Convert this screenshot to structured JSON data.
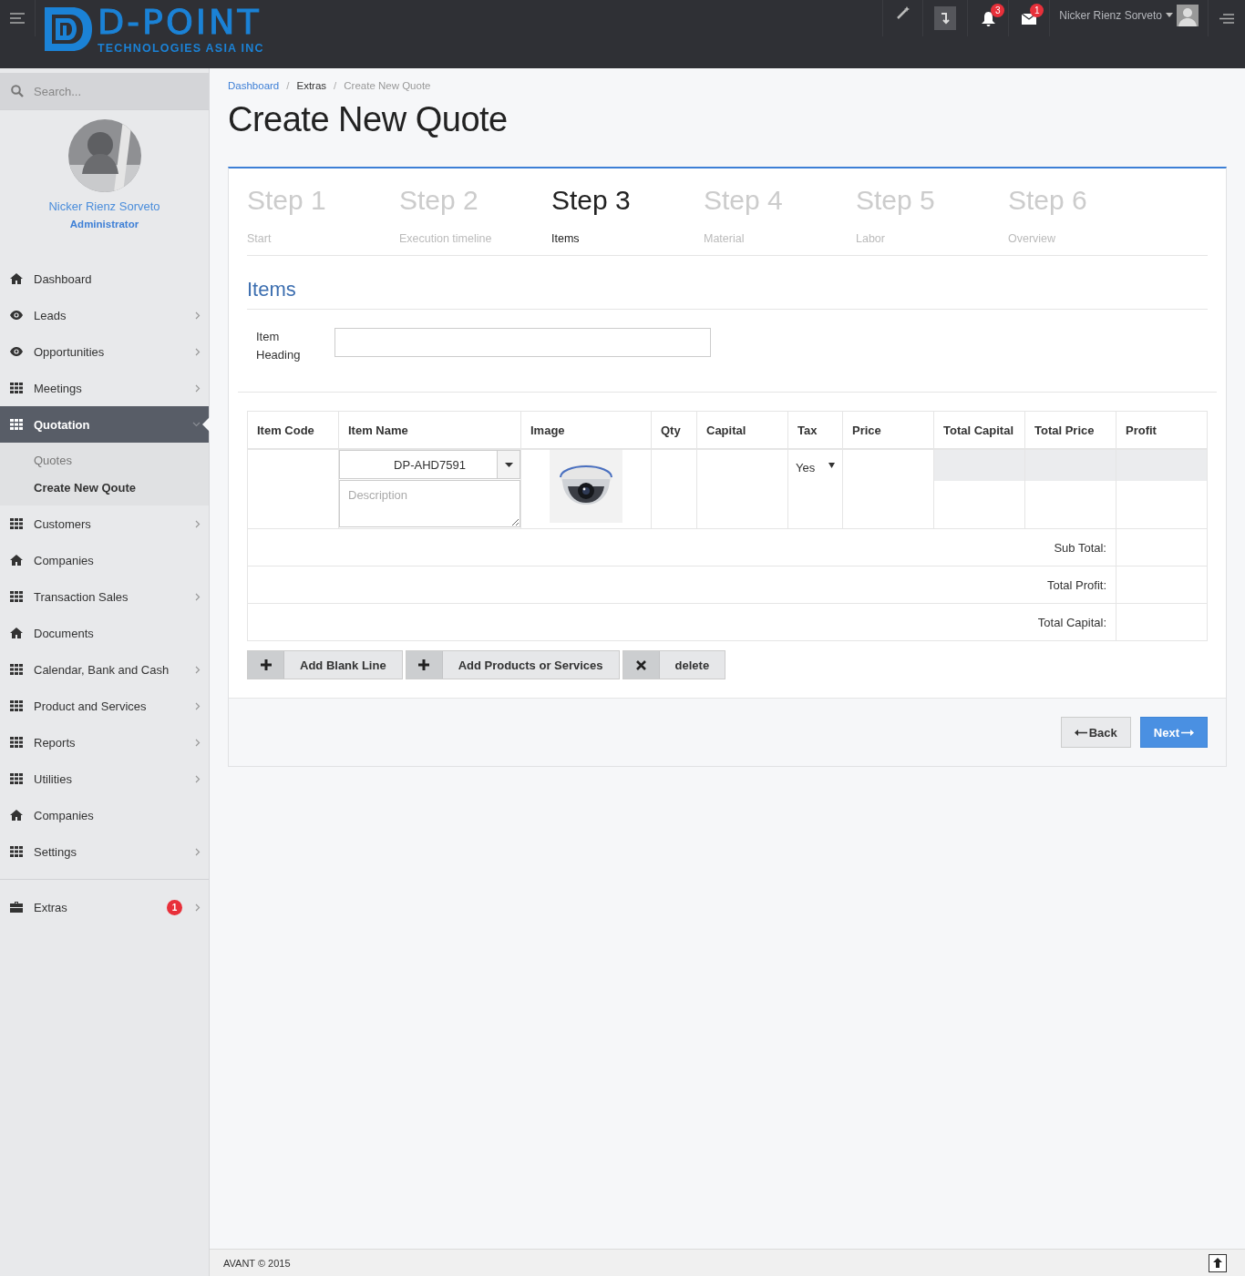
{
  "topbar": {
    "logo_title": "D-POINT",
    "logo_subtitle": "TECHNOLOGIES ASIA INC",
    "notification_count": "3",
    "message_count": "1",
    "user_name": "Nicker Rienz Sorveto"
  },
  "sidebar": {
    "search_placeholder": "Search...",
    "profile": {
      "name": "Nicker Rienz Sorveto",
      "role": "Administrator"
    },
    "items": [
      {
        "label": "Dashboard",
        "kind": "home",
        "selected": false
      },
      {
        "label": "Leads",
        "kind": "eye",
        "expanded": false,
        "selected": false
      },
      {
        "label": "Opportunities",
        "kind": "eye",
        "expanded": false,
        "selected": false
      },
      {
        "label": "Meetings",
        "kind": "grid",
        "expanded": false,
        "selected": false
      },
      {
        "label": "Quotation",
        "kind": "grid",
        "expanded": true,
        "selected": true,
        "children": [
          {
            "label": "Quotes",
            "selected": false
          },
          {
            "label": "Create New Qoute",
            "selected": true
          }
        ]
      },
      {
        "label": "Customers",
        "kind": "grid",
        "expanded": false,
        "selected": false
      },
      {
        "label": "Companies",
        "kind": "home",
        "selected": false
      },
      {
        "label": "Transaction Sales",
        "kind": "grid",
        "expanded": false,
        "selected": false
      },
      {
        "label": "Documents",
        "kind": "home",
        "selected": false
      },
      {
        "label": "Calendar, Bank and Cash",
        "kind": "grid",
        "expanded": false,
        "selected": false
      },
      {
        "label": "Product and Services",
        "kind": "grid",
        "expanded": false,
        "selected": false
      },
      {
        "label": "Reports",
        "kind": "grid",
        "expanded": false,
        "selected": false
      },
      {
        "label": "Utilities",
        "kind": "grid",
        "expanded": false,
        "selected": false
      },
      {
        "label": "Companies",
        "kind": "home",
        "selected": false
      },
      {
        "label": "Settings",
        "kind": "grid",
        "expanded": false,
        "selected": false
      }
    ],
    "footer_items": [
      {
        "label": "Extras",
        "kind": "briefcase",
        "badge": "1",
        "expanded": false,
        "selected": false
      }
    ]
  },
  "breadcrumb": [
    {
      "label": "Dashboard",
      "kind": "link"
    },
    {
      "separator": "/",
      "label": "Extras",
      "kind": "text"
    },
    {
      "separator": "/",
      "label": "Create New Quote",
      "kind": "current"
    }
  ],
  "page_title": "Create New Quote",
  "steps": [
    {
      "title": "Step 1",
      "subtitle": "Start",
      "selected": false
    },
    {
      "title": "Step 2",
      "subtitle": "Execution timeline",
      "selected": false
    },
    {
      "title": "Step 3",
      "subtitle": "Items",
      "selected": true
    },
    {
      "title": "Step 4",
      "subtitle": "Material",
      "selected": false
    },
    {
      "title": "Step 5",
      "subtitle": "Labor",
      "selected": false
    },
    {
      "title": "Step 6",
      "subtitle": "Overview",
      "selected": false
    }
  ],
  "section_title": "Items",
  "item_heading": {
    "label": "Item Heading"
  },
  "table": {
    "columns": [
      "Item Code",
      "Item Name",
      "Image",
      "Qty",
      "Capital",
      "Tax",
      "Price",
      "Total Capital",
      "Total Price",
      "Profit"
    ],
    "rows": [
      {
        "item_name": "DP-AHD7591",
        "description_placeholder": "Description",
        "tax": "Yes"
      }
    ],
    "summary": [
      "Sub Total:",
      "Total Profit:",
      "Total Capital:"
    ]
  },
  "actions": [
    {
      "kind": "plus",
      "label": "Add Blank Line"
    },
    {
      "kind": "plus",
      "label": "Add Products or Services"
    },
    {
      "kind": "times",
      "label": "delete"
    }
  ],
  "nav_buttons": [
    {
      "kind": "back",
      "label": "Back"
    },
    {
      "kind": "next",
      "label": "Next"
    }
  ],
  "footer": {
    "text": "AVANT © 2015"
  }
}
